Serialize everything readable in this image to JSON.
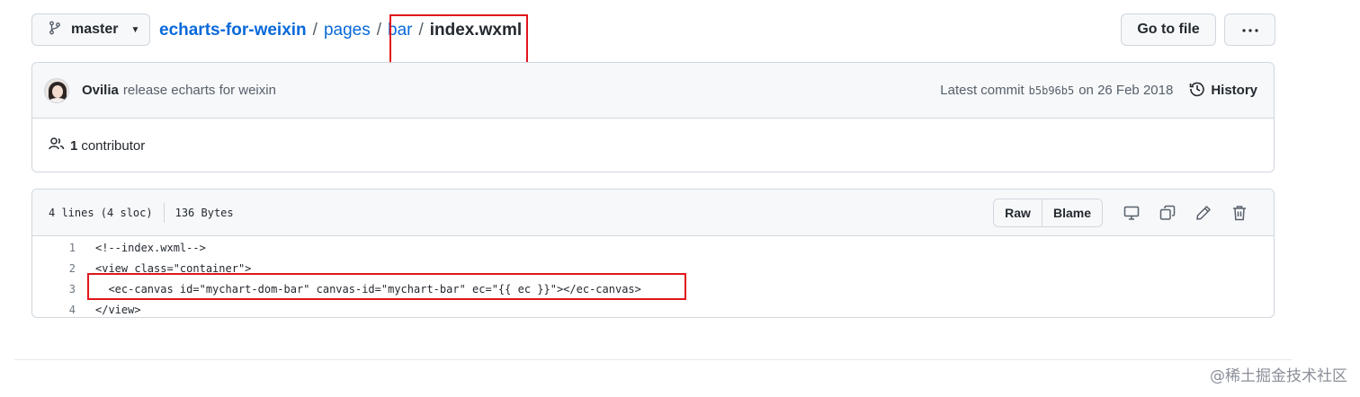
{
  "top": {
    "branch": "master",
    "breadcrumb": {
      "repo": "echarts-for-weixin",
      "sep": "/",
      "folder1": "pages",
      "folder2": "bar",
      "file": "index.wxml"
    },
    "go_to_file": "Go to file",
    "more": "···"
  },
  "commit": {
    "author": "Ovilia",
    "message": "release echarts for weixin",
    "latest_label": "Latest commit",
    "sha": "b5b96b5",
    "date": "on 26 Feb 2018",
    "history": "History",
    "contributors_count": "1",
    "contributors_label": "contributor"
  },
  "file": {
    "lines_info": "4 lines (4 sloc)",
    "size": "136 Bytes",
    "raw_label": "Raw",
    "blame_label": "Blame",
    "code": [
      {
        "n": "1",
        "text": "<!--index.wxml-->"
      },
      {
        "n": "2",
        "text": "<view class=\"container\">"
      },
      {
        "n": "3",
        "text": "  <ec-canvas id=\"mychart-dom-bar\" canvas-id=\"mychart-bar\" ec=\"{{ ec }}\"></ec-canvas>"
      },
      {
        "n": "4",
        "text": "</view>"
      }
    ]
  },
  "watermark": "@稀土掘金技术社区",
  "colors": {
    "accent": "#0969da",
    "highlight": "#e0161b",
    "header_bg": "#f6f8fa",
    "border": "#d0d7de"
  },
  "icons": [
    "git-branch-icon",
    "caret-down-icon",
    "kebab-horizontal-icon",
    "history-icon",
    "people-icon",
    "desktop-icon",
    "copy-icon",
    "pencil-icon",
    "trash-icon"
  ]
}
